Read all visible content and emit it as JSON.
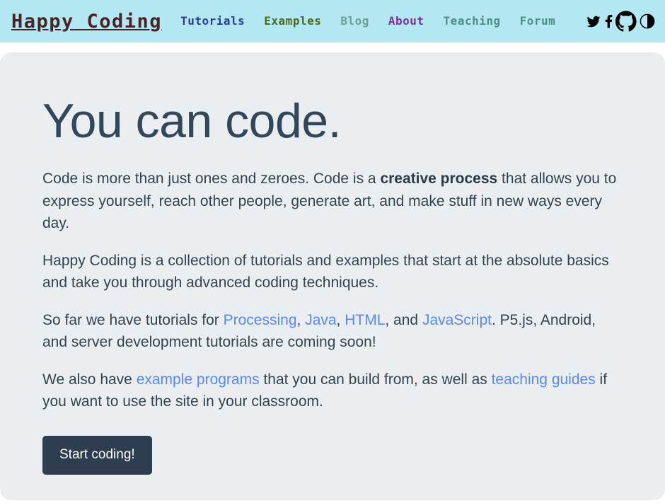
{
  "header": {
    "brand": "Happy Coding",
    "nav": [
      {
        "label": "Tutorials",
        "color": "#2a3d93",
        "name": "nav-link-tutorials"
      },
      {
        "label": "Examples",
        "color": "#4c6b1f",
        "name": "nav-link-examples"
      },
      {
        "label": "Blog",
        "color": "#6f9e95",
        "name": "nav-link-blog"
      },
      {
        "label": "About",
        "color": "#7a2f9e",
        "name": "nav-link-about"
      },
      {
        "label": "Teaching",
        "color": "#4e8f85",
        "name": "nav-link-teaching"
      },
      {
        "label": "Forum",
        "color": "#4e8f85",
        "name": "nav-link-forum"
      }
    ],
    "social": [
      {
        "label": "Twitter",
        "name": "twitter-icon"
      },
      {
        "label": "Facebook",
        "name": "facebook-icon"
      },
      {
        "label": "GitHub",
        "name": "github-icon"
      },
      {
        "label": "Contrast",
        "name": "contrast-toggle-icon"
      }
    ],
    "background": "#b3e7f2",
    "brand_color": "#4a2327"
  },
  "main": {
    "title": "You can code.",
    "paragraph1": {
      "part1": "Code is more than just ones and zeroes. Code is a ",
      "bold": "creative process",
      "part2": " that allows you to express yourself, reach other people, generate art, and make stuff in new ways every day."
    },
    "paragraph2": "Happy Coding is a collection of tutorials and examples that start at the absolute basics and take you through advanced coding techniques.",
    "paragraph3": {
      "part1": "So far we have tutorials for ",
      "link1": "Processing",
      "sep1": ", ",
      "link2": "Java",
      "sep2": ", ",
      "link3": "HTML",
      "sep3": ", and ",
      "link4": "JavaScript",
      "part2": ". P5.js, Android, and server development tutorials are coming soon!"
    },
    "paragraph4": {
      "part1": "We also have ",
      "link1": "example programs",
      "part2": " that you can build from, as well as ",
      "link2": "teaching guides",
      "part3": " if you want to use the site in your classroom."
    },
    "cta_button": "Start coding!",
    "card_background": "#eaeef0",
    "text_color": "#34444f",
    "link_color": "#5a87f7",
    "button_background": "#2e3e50"
  }
}
